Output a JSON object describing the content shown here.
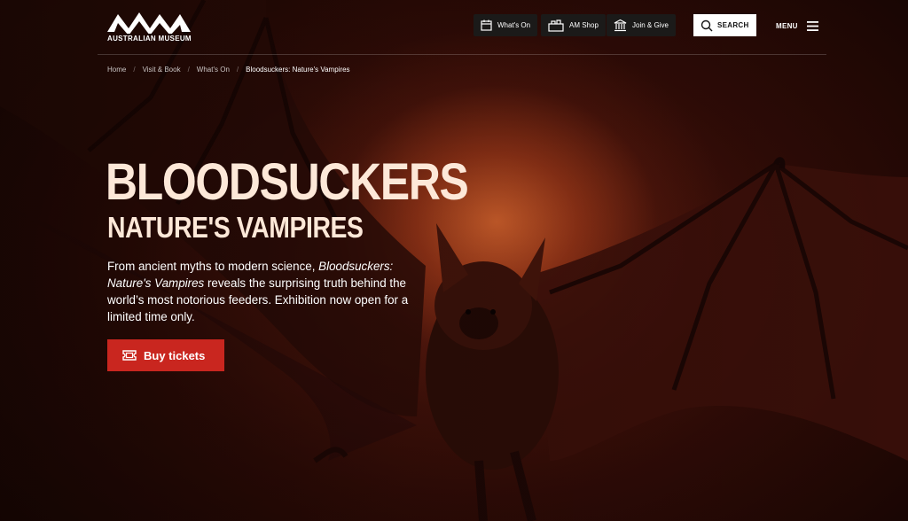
{
  "header": {
    "logo_text": "AUSTRALIAN MUSEUM",
    "nav": [
      {
        "label": "What's On",
        "icon": "calendar-icon"
      },
      {
        "label": "AM Shop",
        "icon": "shop-icon"
      },
      {
        "label": "Join & Give",
        "icon": "museum-building-icon"
      }
    ],
    "search_label": "SEARCH",
    "menu_label": "MENU"
  },
  "breadcrumb": {
    "items": [
      "Home",
      "Visit & Book",
      "What's On"
    ],
    "separator": "/",
    "current": "Bloodsuckers: Nature's Vampires"
  },
  "hero": {
    "title": "BLOODSUCKERS",
    "subtitle": "NATURE'S VAMPIRES",
    "desc_pre": "From ancient myths to modern science, ",
    "desc_em": "Bloodsuckers: Nature's Vampires",
    "desc_post": " reveals the surprising truth behind the world’s most notorious feeders. Exhibition now open for a limited time only.",
    "cta_label": "Buy tickets",
    "cta_icon": "ticket-icon"
  },
  "colors": {
    "cta": "#c9261f",
    "title": "#fde8d8",
    "nav_button": "#1b1a19",
    "background": "#1a0705"
  }
}
